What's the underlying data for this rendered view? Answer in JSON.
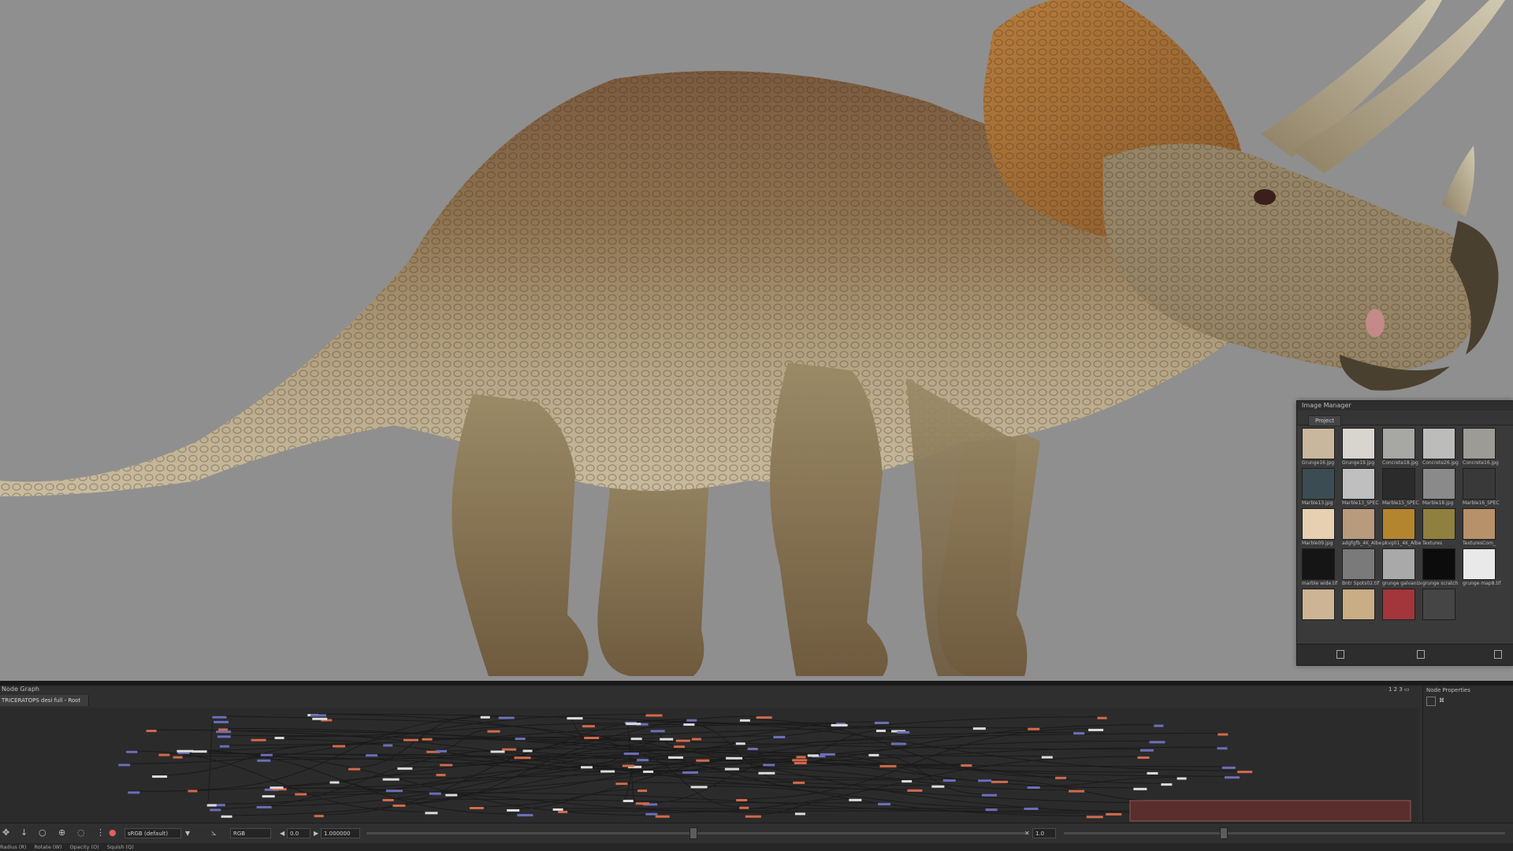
{
  "image_manager": {
    "title": "Image Manager",
    "tab": "Project",
    "thumbnails": [
      {
        "label": "Grunge16.jpg",
        "color": "#c9b79d"
      },
      {
        "label": "Grunge19.jpg",
        "color": "#d8d5cf"
      },
      {
        "label": "Concrete18.jpg",
        "color": "#a7a7a3"
      },
      {
        "label": "Concrete26.jpg",
        "color": "#bcbcbb"
      },
      {
        "label": "Concrete16.jpg",
        "color": "#9d9b95"
      },
      {
        "label": "Marble13.jpg",
        "color": "#3b4d52"
      },
      {
        "label": "Marble13_SPEC",
        "color": "#bfbfbf"
      },
      {
        "label": "Marble15_SPEC",
        "color": "#2b2b2b"
      },
      {
        "label": "Marble18.jpg",
        "color": "#8a8a8a"
      },
      {
        "label": "Marble16_SPEC",
        "color": "#393939"
      },
      {
        "label": "Marble09.jpg",
        "color": "#e6d0b1"
      },
      {
        "label": "adgfgfb_4K_Albedo",
        "color": "#b89a7d"
      },
      {
        "label": "pkvg01_4K_Albe",
        "color": "#b4852f"
      },
      {
        "label": "Textures",
        "color": "#8f8040"
      },
      {
        "label": "TexturesCom_",
        "color": "#b7916a"
      },
      {
        "label": "marble wide.tif",
        "color": "#151515"
      },
      {
        "label": "Bntr Spots02.tif",
        "color": "#7a7a7a"
      },
      {
        "label": "grunge galvanize",
        "color": "#a9a9a9"
      },
      {
        "label": "grunge scratch",
        "color": "#0c0c0c"
      },
      {
        "label": "grunge map8.tif",
        "color": "#e9e9e9"
      },
      {
        "label": "",
        "color": "#cdb494"
      },
      {
        "label": "",
        "color": "#c9ad84"
      },
      {
        "label": "",
        "color": "#a2363a"
      },
      {
        "label": "",
        "color": "#454545"
      }
    ]
  },
  "node_graph": {
    "title": "Node Graph",
    "tab": "TRICERATOPS desi full - Root",
    "zoom": "1 2 3 ▭",
    "properties_title": "Node Properties"
  },
  "toolbar": {
    "colorspace": "sRGB (default)",
    "channel": "RGB",
    "frame": "0.0",
    "value": "1.000000",
    "value2": "1.0"
  },
  "statusbar": {
    "items": [
      "Radius (R)",
      "Rotate (W)",
      "Opacity (O)",
      "Squish (Q)"
    ]
  },
  "colors": {
    "viewport_bg": "#8f8f8f",
    "panel_bg": "#2f2f2f",
    "node_blue": "#6b6fb8",
    "node_red": "#d06a4c",
    "node_white": "#dcdcdc"
  }
}
